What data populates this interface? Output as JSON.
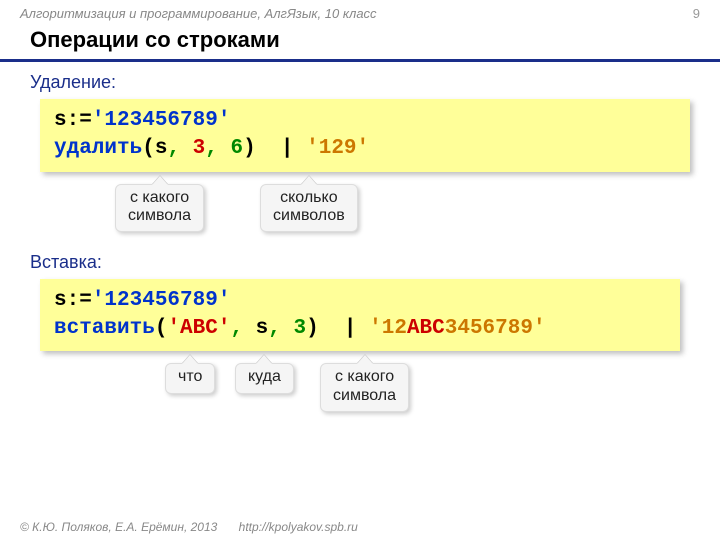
{
  "header": {
    "breadcrumb": "Алгоритмизация и программирование, АлгЯзык, 10 класс",
    "page": "9"
  },
  "title": "Операции со строками",
  "sections": {
    "delete": {
      "label": "Удаление:",
      "code": {
        "line1_var": "s:=",
        "line1_str": "'123456789'",
        "line2_fn": "удалить",
        "line2_open": "(",
        "line2_arg1": "s",
        "line2_sep": ", ",
        "line2_arg2": "3",
        "line2_arg3": "6",
        "line2_close": ")  | ",
        "line2_result": "'129'"
      },
      "callouts": {
        "from": "с какого\nсимвола",
        "count": "сколько\nсимволов"
      }
    },
    "insert": {
      "label": "Вставка:",
      "code": {
        "line1_var": "s:=",
        "line1_str": "'123456789'",
        "line2_fn": "вставить",
        "line2_open": "(",
        "line2_arg1": "'ABC'",
        "line2_sep": ", ",
        "line2_arg2": "s",
        "line2_arg3": "3",
        "line2_close": ")  | ",
        "line2_res_a": "'12",
        "line2_res_b": "ABC",
        "line2_res_c": "3456789'"
      },
      "callouts": {
        "what": "что",
        "where": "куда",
        "from": "с какого\nсимвола"
      }
    }
  },
  "footer": {
    "copyright": "© К.Ю. Поляков, Е.А. Ерёмин, 2013",
    "url": "http://kpolyakov.spb.ru"
  }
}
